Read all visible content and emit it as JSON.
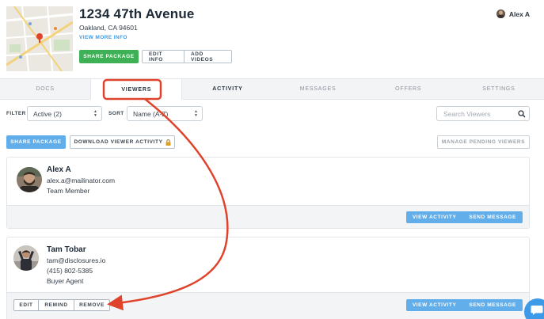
{
  "header": {
    "title": "1234 47th Avenue",
    "subtitle": "Oakland, CA 94601",
    "view_more": "VIEW MORE INFO",
    "share_package": "SHARE PACKAGE",
    "edit_info": "EDIT INFO",
    "add_videos": "ADD VIDEOS",
    "user_name": "Alex A"
  },
  "tabs": [
    {
      "label": "DOCS"
    },
    {
      "label": "VIEWERS"
    },
    {
      "label": "ACTIVITY"
    },
    {
      "label": "MESSAGES"
    },
    {
      "label": "OFFERS"
    },
    {
      "label": "SETTINGS"
    }
  ],
  "filters": {
    "filter_label": "FILTER",
    "filter_value": "Active (2)",
    "sort_label": "SORT",
    "sort_value": "Name (A-Z)",
    "search_placeholder": "Search Viewers"
  },
  "actions": {
    "share_package": "SHARE PACKAGE",
    "download_activity": "DOWNLOAD VIEWER ACTIVITY",
    "manage_pending": "MANAGE PENDING VIEWERS"
  },
  "viewers": [
    {
      "name": "Alex A",
      "email": "alex.a@mailinator.com",
      "role": "Team Member",
      "view_activity": "VIEW ACTIVITY",
      "send_message": "SEND MESSAGE"
    },
    {
      "name": "Tam Tobar",
      "email": "tam@disclosures.io",
      "phone": "(415) 802-5385",
      "role": "Buyer Agent",
      "edit": "EDIT",
      "remind": "REMIND",
      "remove": "REMOVE",
      "view_activity": "VIEW ACTIVITY",
      "send_message": "SEND MESSAGE"
    }
  ],
  "colors": {
    "green": "#3eb055",
    "blue": "#62aeea",
    "link": "#3d9ae8",
    "annotation": "#e0432b"
  }
}
